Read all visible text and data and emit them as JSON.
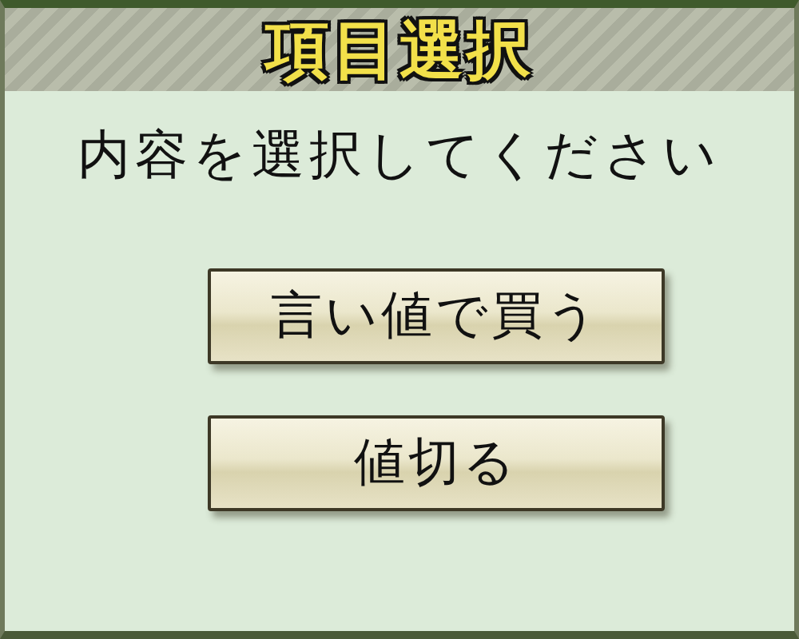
{
  "header": {
    "title": "項目選択"
  },
  "prompt": "内容を選択してください",
  "options": [
    {
      "label": "言い値で買う"
    },
    {
      "label": "値切る"
    }
  ]
}
